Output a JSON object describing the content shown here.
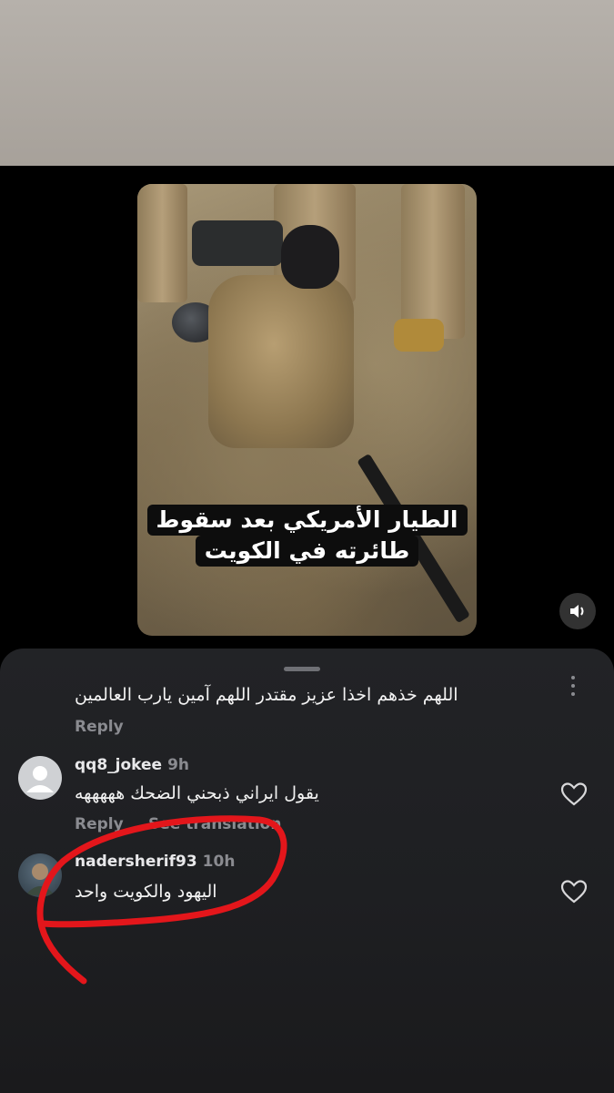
{
  "video": {
    "caption_line1": "الطيار الأمريكي بعد سقوط",
    "caption_line2": "طائرته في الكويت"
  },
  "comments": [
    {
      "text": "اللهم خذهم اخذا عزيز مقتدر اللهم آمين يارب العالمين",
      "reply_label": "Reply"
    },
    {
      "username": "qq8_jokee",
      "time": "9h",
      "text": "يقول ايراني ذبحني الضحك هههههه",
      "reply_label": "Reply",
      "see_translation": "See translation"
    },
    {
      "username": "nadersherif93",
      "time": "10h",
      "text": "اليهود والكويت واحد"
    }
  ],
  "colors": {
    "sheet_bg": "#222326",
    "secondary_text": "#8a8b90",
    "annotation_red": "#e3161b"
  }
}
